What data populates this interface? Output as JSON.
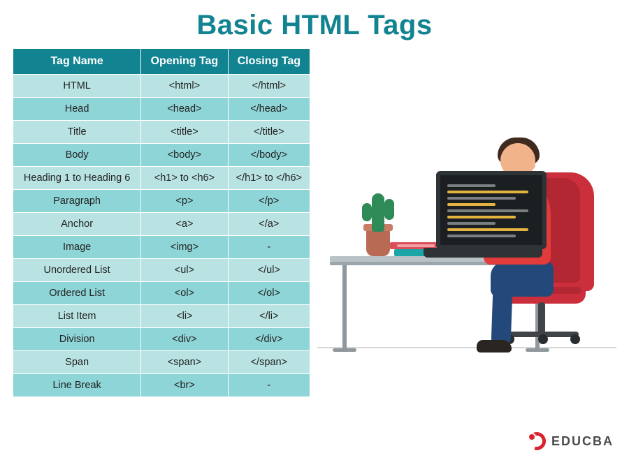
{
  "title": "Basic HTML Tags",
  "columns": [
    "Tag Name",
    "Opening Tag",
    "Closing Tag"
  ],
  "rows": [
    {
      "name": "HTML",
      "open": "<html>",
      "close": "</html>"
    },
    {
      "name": "Head",
      "open": "<head>",
      "close": "</head>"
    },
    {
      "name": "Title",
      "open": "<title>",
      "close": "</title>"
    },
    {
      "name": "Body",
      "open": "<body>",
      "close": "</body>"
    },
    {
      "name": "Heading 1 to Heading 6",
      "open": "<h1> to <h6>",
      "close": "</h1> to </h6>"
    },
    {
      "name": "Paragraph",
      "open": "<p>",
      "close": "</p>"
    },
    {
      "name": "Anchor",
      "open": "<a>",
      "close": "</a>"
    },
    {
      "name": "Image",
      "open": "<img>",
      "close": "-"
    },
    {
      "name": "Unordered List",
      "open": "<ul>",
      "close": "</ul>"
    },
    {
      "name": "Ordered List",
      "open": "<ol>",
      "close": "</ol>"
    },
    {
      "name": "List Item",
      "open": "<li>",
      "close": "</li>"
    },
    {
      "name": "Division",
      "open": "<div>",
      "close": "</div>"
    },
    {
      "name": "Span",
      "open": "<span>",
      "close": "</span>"
    },
    {
      "name": "Line Break",
      "open": "<br>",
      "close": "-"
    }
  ],
  "logo_text": "EDUCBA"
}
